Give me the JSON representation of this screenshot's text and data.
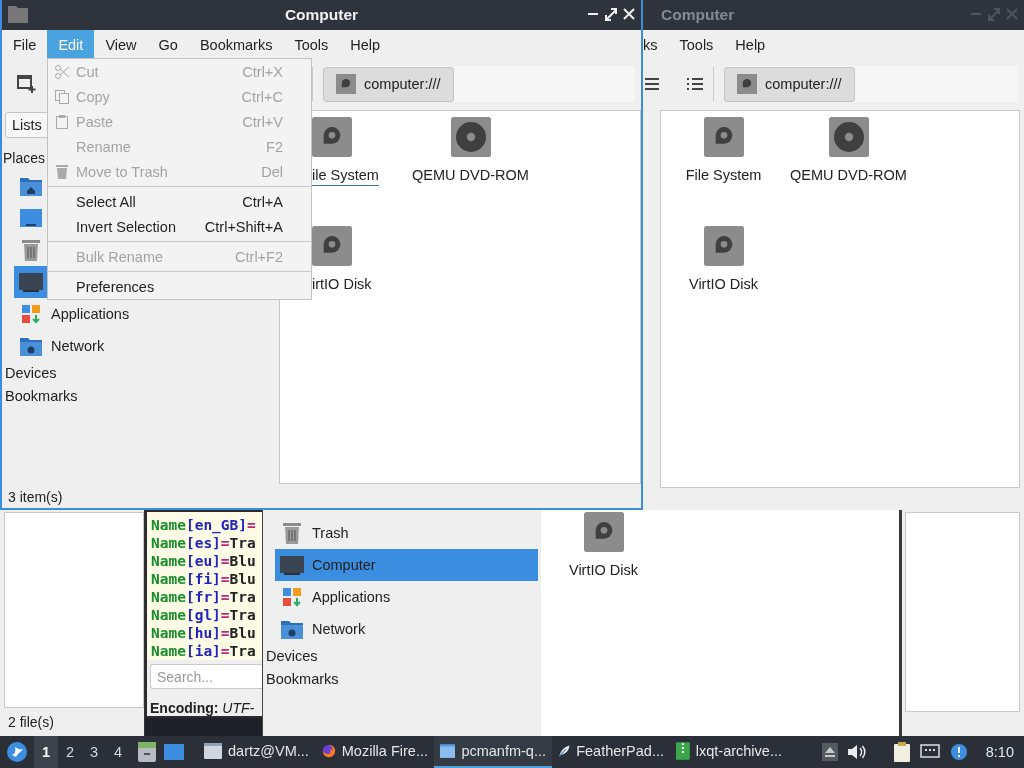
{
  "back_window": {
    "status_bar": "2 file(s)"
  },
  "text_editor": {
    "lines": [
      [
        {
          "kind": "key",
          "text": "Name"
        },
        {
          "kind": "locale",
          "text": "[en_GB]"
        },
        {
          "kind": "op",
          "text": "="
        }
      ],
      [
        {
          "kind": "key",
          "text": "Name"
        },
        {
          "kind": "locale",
          "text": "[es]"
        },
        {
          "kind": "op",
          "text": "="
        },
        {
          "kind": "value",
          "text": "Tra"
        }
      ],
      [
        {
          "kind": "key",
          "text": "Name"
        },
        {
          "kind": "locale",
          "text": "[eu]"
        },
        {
          "kind": "op",
          "text": "="
        },
        {
          "kind": "value",
          "text": "Blu"
        }
      ],
      [
        {
          "kind": "key",
          "text": "Name"
        },
        {
          "kind": "locale",
          "text": "[fi]"
        },
        {
          "kind": "op",
          "text": "="
        },
        {
          "kind": "value",
          "text": "Blu"
        }
      ],
      [
        {
          "kind": "key",
          "text": "Name"
        },
        {
          "kind": "locale",
          "text": "[fr]"
        },
        {
          "kind": "op",
          "text": "="
        },
        {
          "kind": "value",
          "text": "Tra"
        }
      ],
      [
        {
          "kind": "key",
          "text": "Name"
        },
        {
          "kind": "locale",
          "text": "[gl]"
        },
        {
          "kind": "op",
          "text": "="
        },
        {
          "kind": "value",
          "text": "Tra"
        }
      ],
      [
        {
          "kind": "key",
          "text": "Name"
        },
        {
          "kind": "locale",
          "text": "[hu]"
        },
        {
          "kind": "op",
          "text": "="
        },
        {
          "kind": "value",
          "text": "Blu"
        }
      ],
      [
        {
          "kind": "key",
          "text": "Name"
        },
        {
          "kind": "locale",
          "text": "[ia]"
        },
        {
          "kind": "op",
          "text": "="
        },
        {
          "kind": "value",
          "text": "Tra"
        }
      ]
    ],
    "search": {
      "placeholder": "Search..."
    },
    "encoding": {
      "label": "Encoding:",
      "value": "UTF-"
    }
  },
  "file_manager_back": {
    "places": [
      {
        "kind": "trash",
        "label": "Trash",
        "selected": false
      },
      {
        "kind": "computer",
        "label": "Computer",
        "selected": true
      },
      {
        "kind": "applications",
        "label": "Applications",
        "selected": false
      },
      {
        "kind": "network",
        "label": "Network",
        "selected": false
      }
    ],
    "sections": [
      "Devices",
      "Bookmarks"
    ],
    "files": [
      {
        "kind": "disk",
        "label": "VirtIO Disk"
      }
    ]
  },
  "inactive_window": {
    "title": "Computer",
    "active": false,
    "menu": [
      {
        "label": "ks",
        "selected": false
      },
      {
        "label": "Tools",
        "selected": false
      },
      {
        "label": "Help",
        "selected": false
      }
    ],
    "path": "computer:///",
    "files": [
      {
        "kind": "disk",
        "label": "File System"
      },
      {
        "kind": "dvd",
        "label": "QEMU DVD-ROM"
      },
      {
        "kind": "disk",
        "label": "VirtIO Disk"
      }
    ]
  },
  "active_window": {
    "title": "Computer",
    "active": true,
    "menu": [
      {
        "label": "File",
        "selected": false
      },
      {
        "label": "Edit",
        "selected": true
      },
      {
        "label": "View",
        "selected": false
      },
      {
        "label": "Go",
        "selected": false
      },
      {
        "label": "Bookmarks",
        "selected": false
      },
      {
        "label": "Tools",
        "selected": false
      },
      {
        "label": "Help",
        "selected": false
      }
    ],
    "path": "computer:///",
    "view_mode": "Lists",
    "places_heading": "Places",
    "places": [
      {
        "kind": "home",
        "selected": false
      },
      {
        "kind": "desktop",
        "selected": false
      },
      {
        "kind": "trash",
        "selected": false
      },
      {
        "kind": "computer",
        "selected": true
      },
      {
        "kind": "applications",
        "label": "Applications",
        "selected": false
      },
      {
        "kind": "network",
        "label": "Network",
        "selected": false
      }
    ],
    "sections": [
      "Devices",
      "Bookmarks"
    ],
    "files": [
      {
        "kind": "disk",
        "label": "ile System",
        "focused": true
      },
      {
        "kind": "dvd",
        "label": "QEMU DVD-ROM",
        "focused": false
      },
      {
        "kind": "disk",
        "label": "irtIO Disk",
        "focused": false
      }
    ],
    "status_bar": "3 item(s)"
  },
  "edit_menu": {
    "items": [
      {
        "kind": "item",
        "label": "Cut",
        "shortcut": "Ctrl+X",
        "disabled": true
      },
      {
        "kind": "item",
        "label": "Copy",
        "shortcut": "Ctrl+C",
        "disabled": true
      },
      {
        "kind": "item",
        "label": "Paste",
        "shortcut": "Ctrl+V",
        "disabled": true
      },
      {
        "kind": "item",
        "label": "Rename",
        "shortcut": "F2",
        "disabled": true
      },
      {
        "kind": "item",
        "label": "Move to Trash",
        "shortcut": "Del",
        "disabled": true
      },
      {
        "kind": "separator"
      },
      {
        "kind": "item",
        "label": "Select All",
        "shortcut": "Ctrl+A",
        "disabled": false
      },
      {
        "kind": "item",
        "label": "Invert Selection",
        "shortcut": "Ctrl+Shift+A",
        "disabled": false
      },
      {
        "kind": "separator"
      },
      {
        "kind": "item",
        "label": "Bulk Rename",
        "shortcut": "Ctrl+F2",
        "disabled": true
      },
      {
        "kind": "separator"
      },
      {
        "kind": "item",
        "label": "Preferences",
        "disabled": false
      }
    ]
  },
  "taskbar": {
    "workspaces": [
      {
        "label": "1",
        "selected": true
      },
      {
        "label": "2",
        "selected": false
      },
      {
        "label": "3",
        "selected": false
      },
      {
        "label": "4",
        "selected": false
      }
    ],
    "tasks": [
      {
        "kind": "terminal",
        "label": "dartz@VM...",
        "selected": false
      },
      {
        "kind": "browser",
        "label": "Mozilla Fire...",
        "selected": false
      },
      {
        "kind": "folder",
        "label": "pcmanfm-q...",
        "selected": true
      },
      {
        "kind": "feather",
        "label": "FeatherPad...",
        "selected": false
      },
      {
        "kind": "archive",
        "label": "lxqt-archive...",
        "selected": false
      }
    ],
    "clock": "8:10"
  }
}
